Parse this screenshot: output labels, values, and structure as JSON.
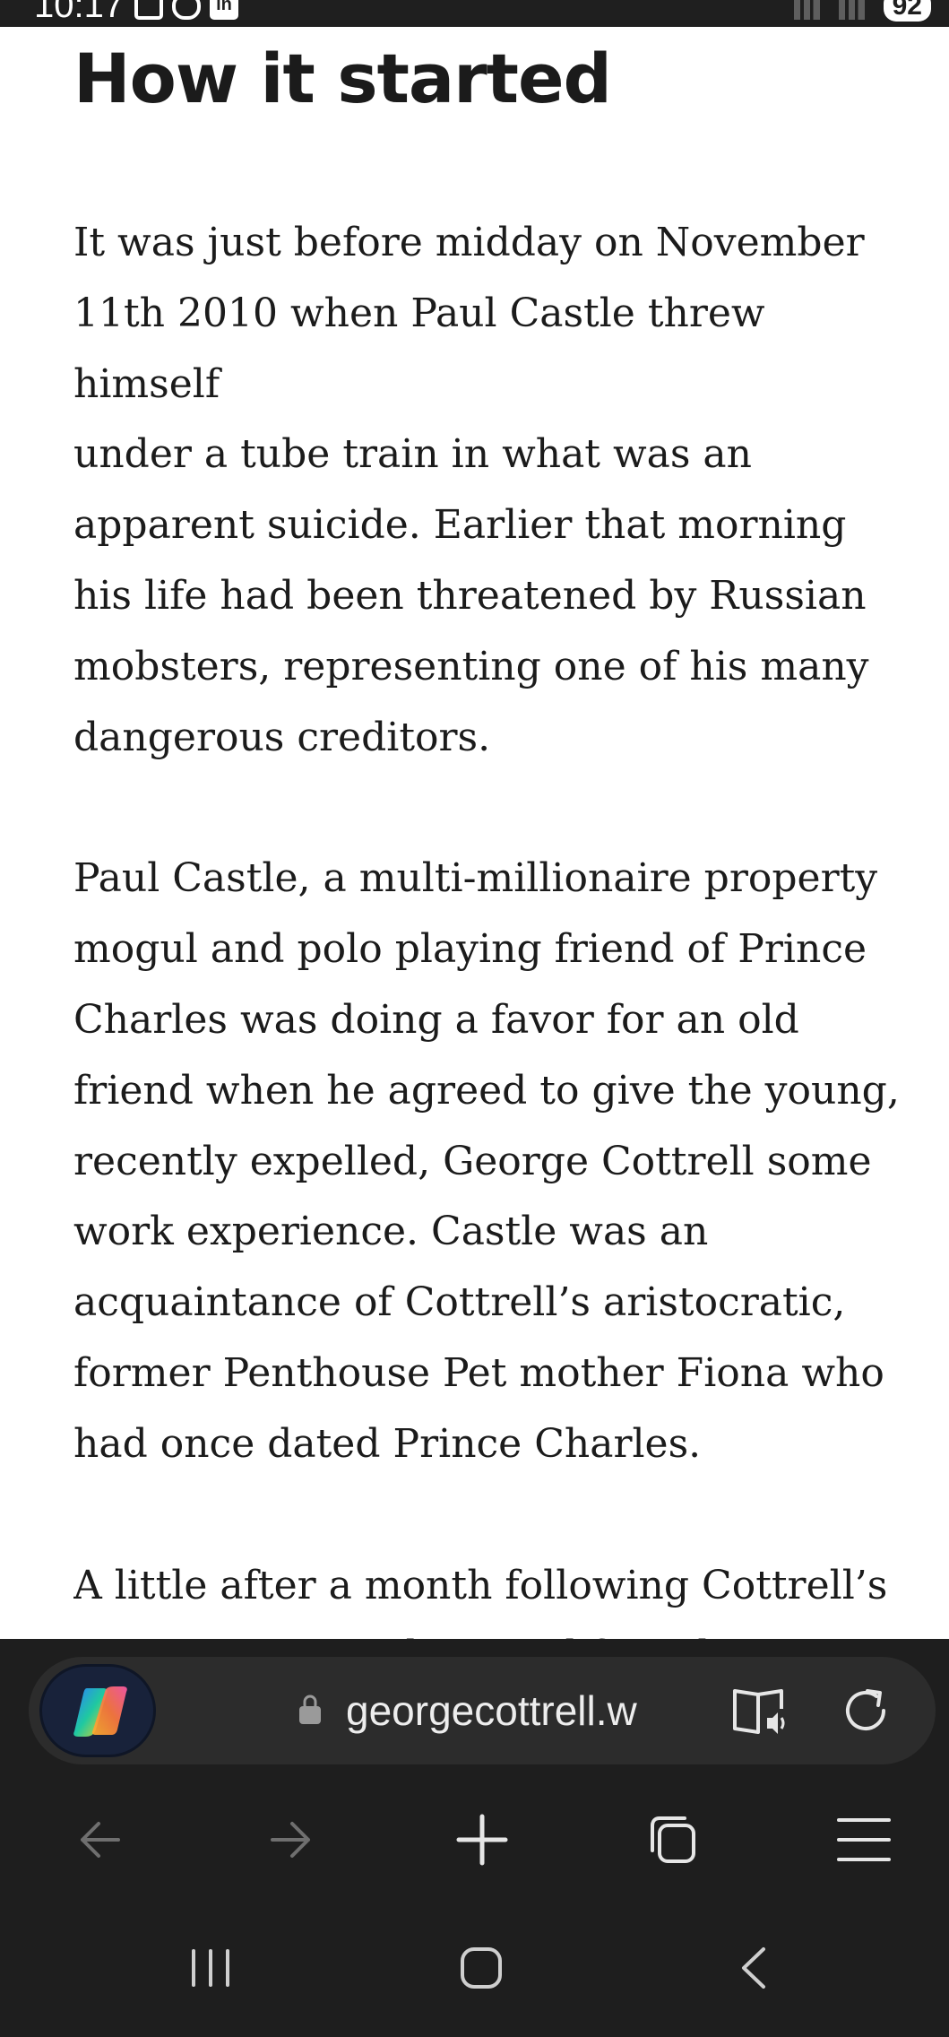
{
  "status_bar": {
    "time": "10:17",
    "battery": "92",
    "linkedin_label": "in"
  },
  "article": {
    "title": "How it started",
    "paragraphs": [
      "It was just before midday on November\n11th 2010 when Paul Castle threw himself\nunder a tube train in what was an\napparent suicide. Earlier that morning\nhis life had been threatened by Russian\nmobsters, representing one of his many\ndangerous creditors.",
      "Paul Castle, a multi-millionaire property\nmogul and polo playing friend of Prince\nCharles was doing a favor for an old\nfriend when he agreed to give the young,\nrecently expelled, George Cottrell some\nwork experience. Castle was an\nacquaintance of Cottrell’s aristocratic,\nformer Penthouse Pet mother Fiona who\nhad once dated Prince Charles.",
      "A little after a month following Cottrell’s\nunceremonious dismissal from his\nexclusive boarding school — due to his"
    ]
  },
  "browser": {
    "url": "georgecottrell.w",
    "icons": {
      "copilot": "copilot-icon",
      "lock": "lock-icon",
      "reader": "reader-mode-icon",
      "refresh": "refresh-icon",
      "back": "back-arrow-icon",
      "forward": "forward-arrow-icon",
      "new_tab": "plus-icon",
      "tabs": "tabs-icon",
      "menu": "hamburger-menu-icon"
    }
  },
  "system_nav": {
    "icons": {
      "recents": "recents-icon",
      "home": "home-icon",
      "back": "system-back-icon"
    }
  },
  "colors": {
    "chrome_background": "#1e1e1e",
    "address_bar": "#2c2c2c",
    "text": "#1b1b1b",
    "icon": "#e6e6e6",
    "icon_disabled": "#6f6f6f"
  }
}
